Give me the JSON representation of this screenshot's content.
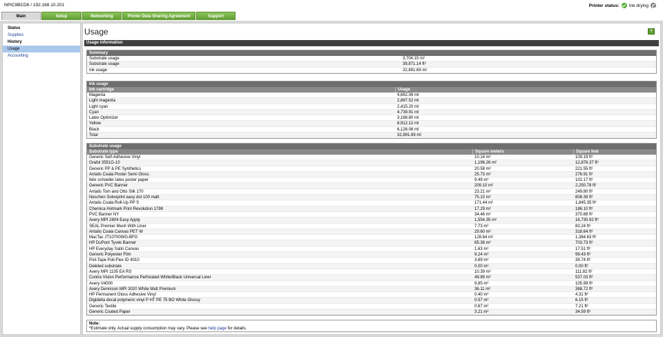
{
  "header": {
    "host": "NPIC9BCD6 / 192.168.10.201",
    "status_label": "Printer status:",
    "status_value": "Ink drying"
  },
  "tabs": [
    "Main",
    "Setup",
    "Networking",
    "Printer Data Sharing Agreement",
    "Support"
  ],
  "sidebar": {
    "items": [
      "Status",
      "Supplies",
      "History",
      "Usage",
      "Accounting"
    ]
  },
  "page": {
    "title": "Usage",
    "help_icon": "?",
    "usage_info_label": "Usage information"
  },
  "summary": {
    "title": "Summary",
    "rows": [
      [
        "Substrate usage",
        "3,704.15 m²"
      ],
      [
        "Substrate usage",
        "39,871.14 ft²"
      ],
      [
        "Ink usage",
        "32,891.69 ml"
      ]
    ]
  },
  "ink": {
    "title": "Ink usage",
    "headers": [
      "Ink cartridge",
      "Usage"
    ],
    "rows": [
      [
        "Magenta",
        "4,662.08 ml"
      ],
      [
        "Light magenta",
        "2,867.52 ml"
      ],
      [
        "Light cyan",
        "2,415.20 ml"
      ],
      [
        "Cyan",
        "4,739.91 ml"
      ],
      [
        "Latex Optimizer",
        "3,168.80 ml"
      ],
      [
        "Yellow",
        "8,912.12 ml"
      ],
      [
        "Black",
        "6,126.06 ml"
      ],
      [
        "Total",
        "32,891.69 ml"
      ]
    ]
  },
  "substrate": {
    "title": "Substrate usage",
    "headers": [
      "Substrate type",
      "Square meters",
      "Square feet"
    ],
    "rows": [
      [
        "Generic Self-Adhesive Vinyl",
        "10.14 m²",
        "109.19 ft²"
      ],
      [
        "Orafol 3551G-10",
        "1,196.26 m²",
        "12,876.37 ft²"
      ],
      [
        "Generic PP & PE Synthetics",
        "20.58 m²",
        "221.55 ft²"
      ],
      [
        "Antalis Coala Poster Semi Gloss",
        "25.73 m²",
        "276.91 ft²"
      ],
      [
        "felix schoeller latex poster paper",
        "9.49 m²",
        "102.17 ft²"
      ],
      [
        "Generic PVC Banner",
        "209.10 m²",
        "2,250.78 ft²"
      ],
      [
        "Antalis Tom and Otto Silk 170",
        "23.21 m²",
        "249.80 ft²"
      ],
      [
        "Neschen Solvoprint easy dot 100 matt",
        "75.10 m²",
        "808.39 ft²"
      ],
      [
        "Antalis Coala Roll-Up PP S",
        "171.44 m²",
        "1,845.35 ft²"
      ],
      [
        "Chemica Hotmark Print Revolution 1798",
        "17.29 m²",
        "186.10 ft²"
      ],
      [
        "PVC Banner NY",
        "34.46 m²",
        "370.88 ft²"
      ],
      [
        "Avery MPI 2804 Easy Apply",
        "1,554.35 m²",
        "16,730.92 ft²"
      ],
      [
        "SEAL Premier Mesh With Liner",
        "7.73 m²",
        "83.24 ft²"
      ],
      [
        "Antalis Coala Canvas PET W",
        "29.60 m²",
        "318.64 ft²"
      ],
      [
        "MacTac JT10700WG-BFG",
        "128.64 m²",
        "1,384.63 ft²"
      ],
      [
        "HP DuPont Tyvek Banner",
        "65.38 m²",
        "703.73 ft²"
      ],
      [
        "HP Everyday Satin Canvas",
        "1.63 m²",
        "17.51 ft²"
      ],
      [
        "Generic Polyester Film",
        "9.24 m²",
        "99.43 ft²"
      ],
      [
        "Poli-Tape Poli-Flex ID 4010",
        "3.69 m²",
        "39.74 ft²"
      ],
      [
        "Deleted substrate",
        "0.00 m²",
        "0.00 ft²"
      ],
      [
        "Avery MPI 1105 EA RS",
        "10.39 m²",
        "111.82 ft²"
      ],
      [
        "Contra Vision Performance Perforated White/Black Universal Liner",
        "49.89 m²",
        "537.03 ft²"
      ],
      [
        "Avery V4000",
        "9.85 m²",
        "105.99 ft²"
      ],
      [
        "Avery Dennison MPI 3020 White Matt Premium",
        "36.11 m²",
        "388.72 ft²"
      ],
      [
        "HP Permanent Gloss Adhesive Vinyl",
        "0.40 m²",
        "4.31 ft²"
      ],
      [
        "Digidelta decal polymeric vinyl P HT PE 75 BO White Glossy",
        "0.57 m²",
        "6.15 ft²"
      ],
      [
        "Generic Textile",
        "0.67 m²",
        "7.21 ft²"
      ],
      [
        "Generic Coated Paper",
        "3.21 m²",
        "34.59 ft²"
      ]
    ]
  },
  "note": {
    "heading": "Note:",
    "text_before": "*Estimate only. Actual supply consumption may vary. Please see ",
    "link": "help page",
    "text_after": " for details."
  },
  "colors": {
    "tab_green": "#6aa83a",
    "section_dark": "#3f3f3f",
    "link_blue": "#1f3d99",
    "sidebar_active": "#a9c8ec"
  }
}
